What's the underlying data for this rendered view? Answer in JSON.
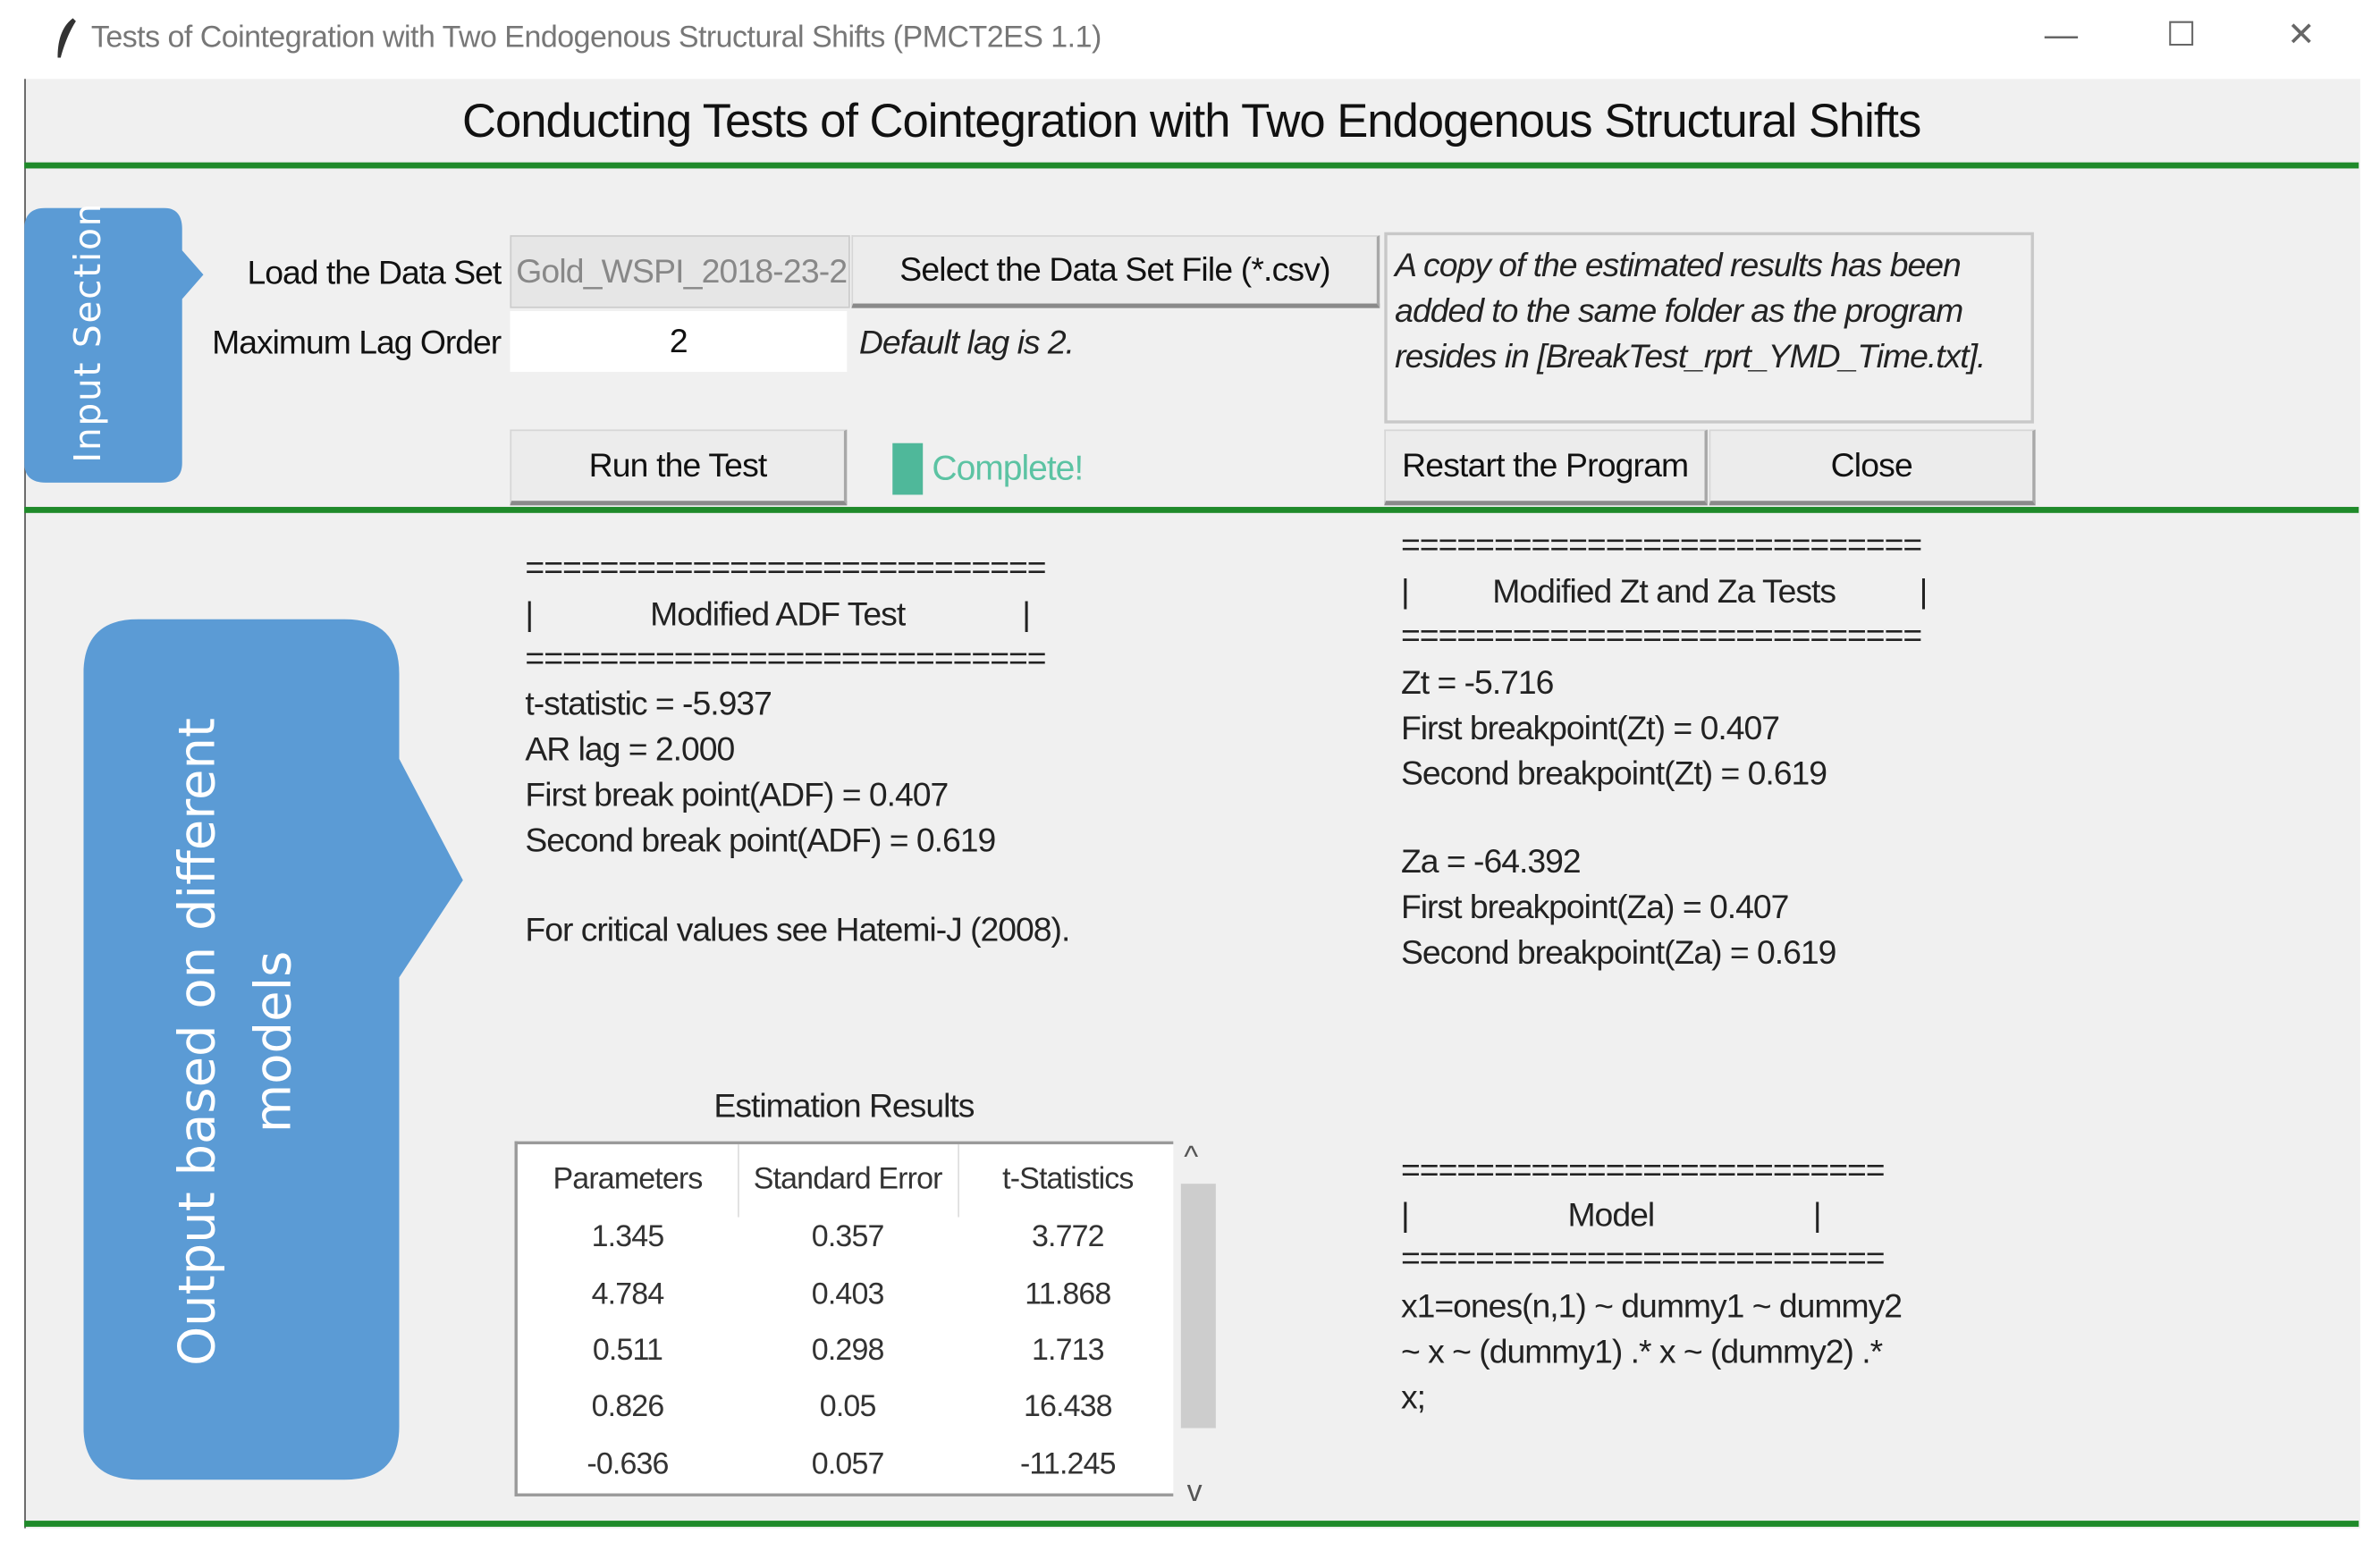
{
  "window": {
    "title": "Tests of Cointegration with Two Endogenous Structural Shifts (PMCT2ES 1.1)",
    "controls": {
      "minimize": "—",
      "maximize": "☐",
      "close": "✕"
    }
  },
  "heading": "Conducting Tests of Cointegration with Two Endogenous Structural Shifts",
  "input_section": {
    "tab_label": "Input Section",
    "load_label": "Load the Data Set",
    "data_file_value": "Gold_WSPI_2018-23-2",
    "select_button": "Select the Data Set File (*.csv)",
    "lag_label": "Maximum Lag Order",
    "lag_value": "2",
    "lag_hint": "Default lag is 2.",
    "message_lines": [
      "A copy of the estimated results has been",
      "added to the same folder as the program",
      "resides in [BreakTest_rprt_YMD_Time.txt]."
    ],
    "run_button": "Run the Test",
    "status": "Complete!",
    "restart_button": "Restart the Program",
    "close_button": "Close"
  },
  "output_section": {
    "tab_line1": "Output based on different",
    "tab_line2": "models",
    "separator": "============================",
    "adf": {
      "header": "|              Modified ADF Test              |",
      "lines": [
        "t-statistic = -5.937",
        "AR lag = 2.000",
        "First break point(ADF) = 0.407",
        "Second break point(ADF) = 0.619"
      ],
      "note": "For critical values see Hatemi-J (2008)."
    },
    "zt_za": {
      "header": "|          Modified Zt and Za Tests          |",
      "zt_lines": [
        "Zt = -5.716",
        "First breakpoint(Zt) = 0.407",
        "Second breakpoint(Zt) = 0.619"
      ],
      "za_lines": [
        "Za = -64.392",
        "First breakpoint(Za) = 0.407",
        "Second breakpoint(Za) = 0.619"
      ]
    },
    "model": {
      "separator": "==========================",
      "header": "|                   Model                   |",
      "lines": [
        "x1=ones(n,1) ~ dummy1 ~ dummy2",
        "~ x ~ (dummy1) .* x ~ (dummy2) .*",
        "x;"
      ]
    },
    "estimation": {
      "title": "Estimation Results",
      "columns": [
        "Parameters",
        "Standard Error",
        "t-Statistics"
      ],
      "rows": [
        [
          "1.345",
          "0.357",
          "3.772"
        ],
        [
          "4.784",
          "0.403",
          "11.868"
        ],
        [
          "0.511",
          "0.298",
          "1.713"
        ],
        [
          "0.826",
          "0.05",
          "16.438"
        ],
        [
          "-0.636",
          "0.057",
          "-11.245"
        ]
      ],
      "scroll_up": "^",
      "scroll_down": "v"
    }
  },
  "colors": {
    "accent_blue": "#5b9bd5",
    "green_rule": "#1f8a2a",
    "status_green": "#4fb89a"
  }
}
